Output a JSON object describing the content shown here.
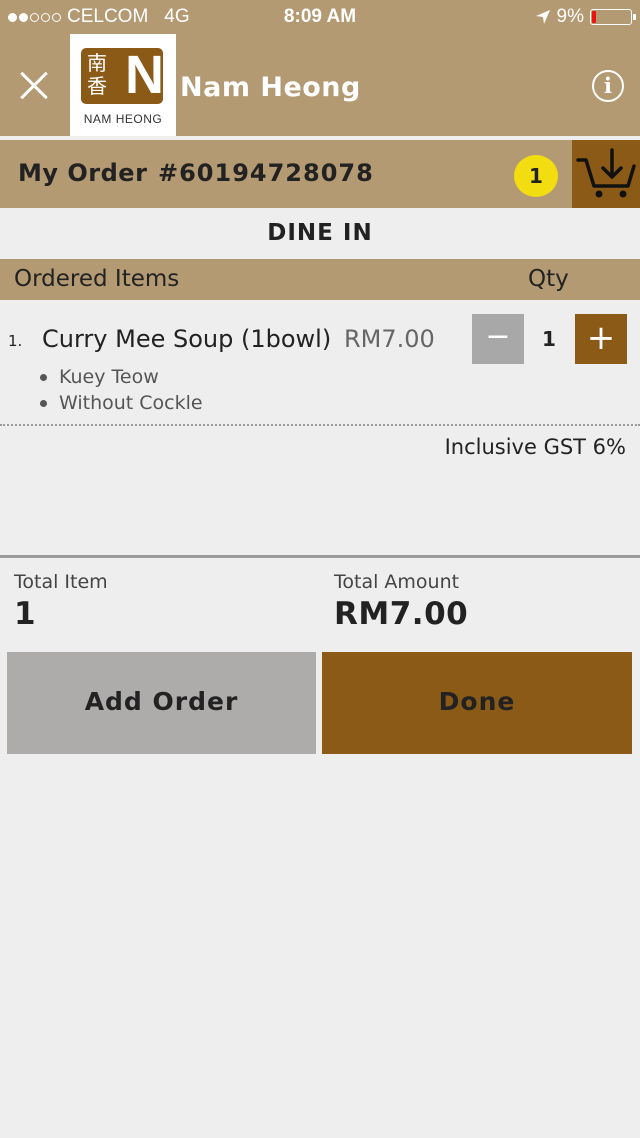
{
  "status_bar": {
    "carrier": "CELCOM",
    "network": "4G",
    "time": "8:09 AM",
    "battery_text": "9%",
    "signal_bars_filled": 2,
    "signal_bars_total": 5,
    "battery_level": 0.09,
    "battery_color": "#e11111"
  },
  "header": {
    "title": "Nam Heong",
    "logo_text": "NAM HEONG",
    "logo_chinese": "南香",
    "logo_letter": "N",
    "close_icon": "close-icon",
    "info_icon": "info-icon",
    "info_glyph": "i"
  },
  "order": {
    "label": "My Order",
    "number": "#60194728078",
    "cart_count": "1",
    "cart_icon": "cart-download-icon"
  },
  "dine_mode": "DINE IN",
  "list_header": {
    "items": "Ordered Items",
    "qty": "Qty"
  },
  "items": [
    {
      "index": "1.",
      "name": "Curry Mee Soup (1bowl)",
      "price": "RM7.00",
      "qty": "1",
      "options": [
        "Kuey Teow",
        "Without Cockle"
      ],
      "minus_label": "−",
      "plus_label": "+"
    }
  ],
  "tax_note": "Inclusive GST 6%",
  "totals": {
    "item_label": "Total Item",
    "item_value": "1",
    "amount_label": "Total Amount",
    "amount_value": "RM7.00"
  },
  "buttons": {
    "add_order": "Add Order",
    "done": "Done"
  },
  "colors": {
    "header_tan": "#b49a72",
    "brand_brown": "#8a5a16",
    "badge_yellow": "#f2dd10",
    "disabled_gray": "#aeabab"
  }
}
